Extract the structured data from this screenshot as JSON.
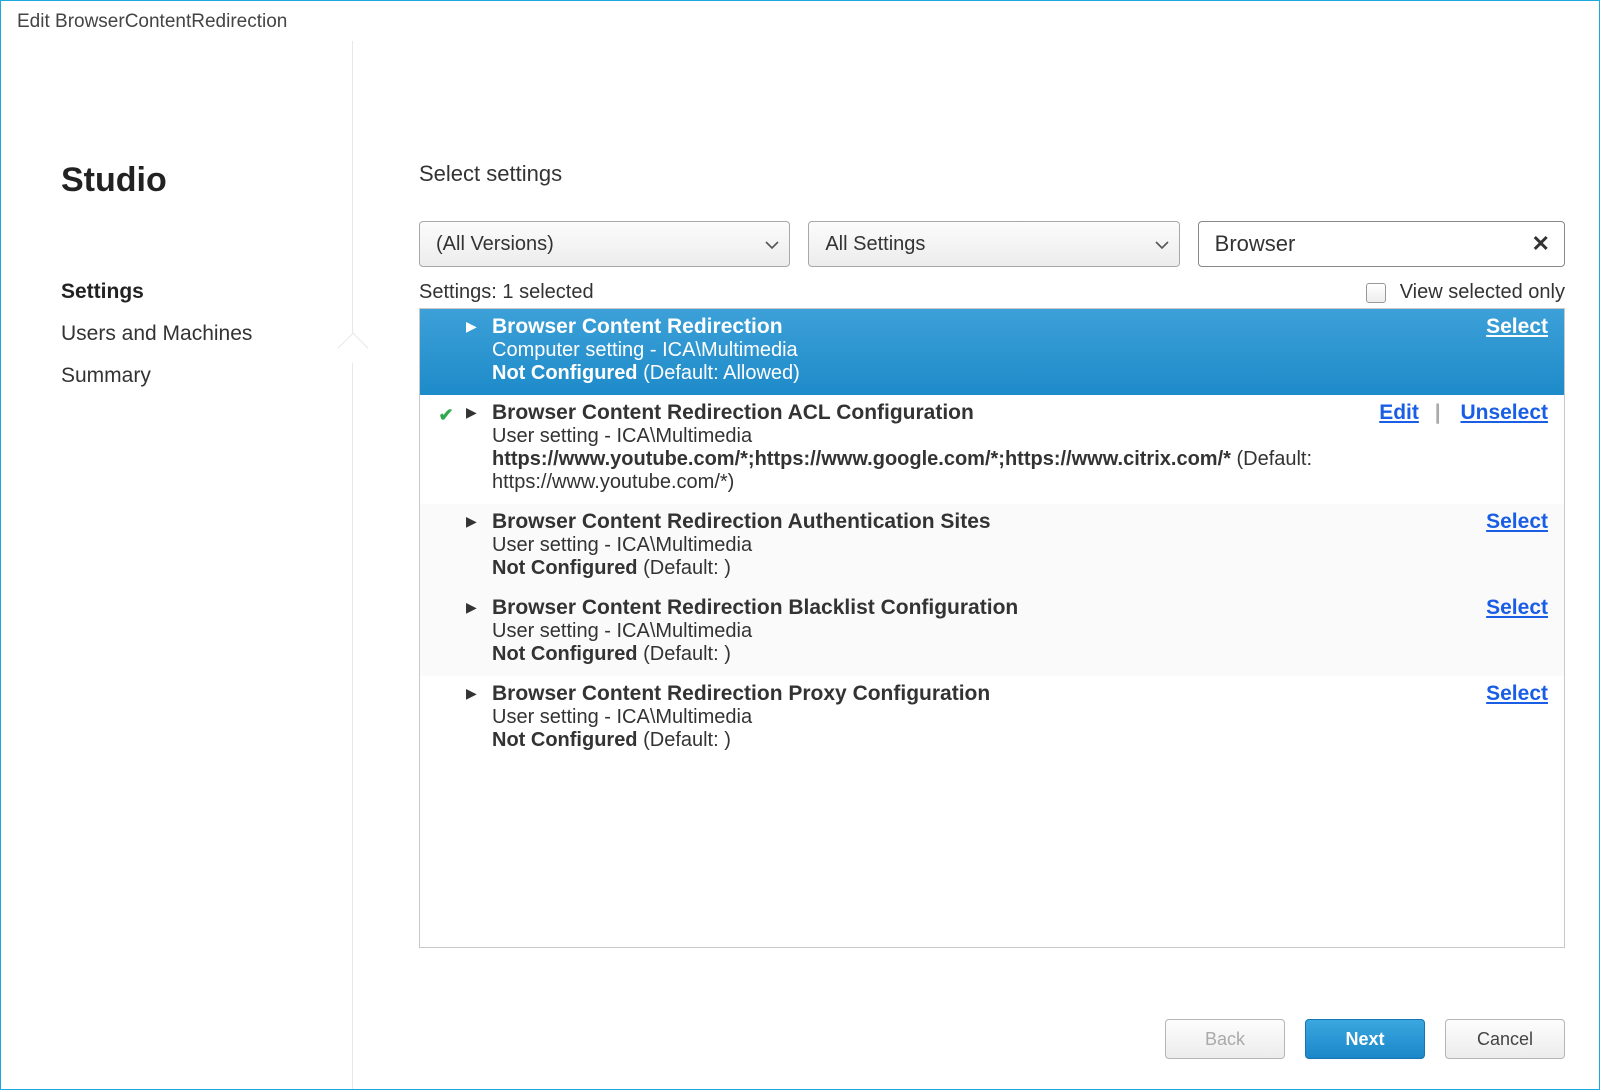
{
  "window": {
    "title": "Edit BrowserContentRedirection"
  },
  "sidebar": {
    "logo": "Studio",
    "items": [
      {
        "label": "Settings",
        "active": true
      },
      {
        "label": "Users and Machines"
      },
      {
        "label": "Summary"
      }
    ]
  },
  "main": {
    "title": "Select settings",
    "version_filter": "(All Versions)",
    "scope_filter": "All Settings",
    "search_value": "Browser",
    "settings_count_label": "Settings:",
    "settings_count_value": "1 selected",
    "view_selected_only": "View selected only"
  },
  "settings_list": [
    {
      "selected": true,
      "has_check": false,
      "title": "Browser Content Redirection",
      "subtitle": "Computer setting - ICA\\Multimedia",
      "config_bold": "Not Configured",
      "config_rest": " (Default: Allowed)",
      "actions": [
        {
          "label": "Select"
        }
      ]
    },
    {
      "has_check": true,
      "title": "Browser Content Redirection ACL Configuration",
      "subtitle": "User setting - ICA\\Multimedia",
      "config_bold": "https://www.youtube.com/*;https://www.google.com/*;https://www.citrix.com/*",
      "config_rest": " (Default: https://www.youtube.com/*)",
      "actions": [
        {
          "label": "Edit"
        },
        {
          "label": "Unselect"
        }
      ]
    },
    {
      "alt": true,
      "title": "Browser Content Redirection Authentication Sites",
      "subtitle": "User setting - ICA\\Multimedia",
      "config_bold": "Not Configured",
      "config_rest": " (Default: )",
      "actions": [
        {
          "label": "Select"
        }
      ]
    },
    {
      "alt": true,
      "title": "Browser Content Redirection Blacklist Configuration",
      "subtitle": "User setting - ICA\\Multimedia",
      "config_bold": "Not Configured",
      "config_rest": " (Default: )",
      "actions": [
        {
          "label": "Select"
        }
      ]
    },
    {
      "title": "Browser Content Redirection Proxy Configuration",
      "subtitle": "User setting - ICA\\Multimedia",
      "config_bold": "Not Configured",
      "config_rest": " (Default: )",
      "actions": [
        {
          "label": "Select"
        }
      ]
    }
  ],
  "buttons": {
    "back": "Back",
    "next": "Next",
    "cancel": "Cancel"
  }
}
